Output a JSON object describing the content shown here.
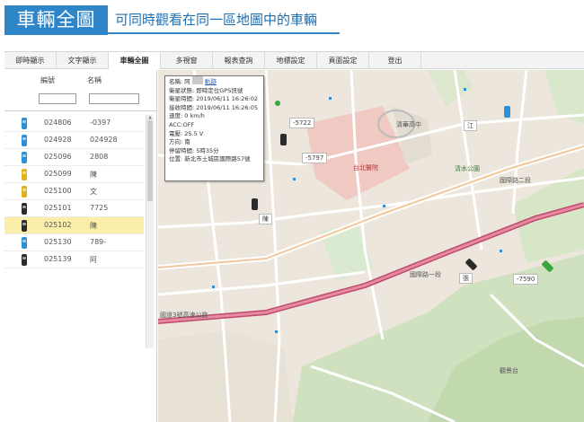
{
  "header": {
    "title": "車輛全圖",
    "subtitle": "可同時觀看在同一區地圖中的車輛"
  },
  "tabs": [
    {
      "label": "即時顯示",
      "active": false
    },
    {
      "label": "文字顯示",
      "active": false
    },
    {
      "label": "車輛全圖",
      "active": true
    },
    {
      "label": "多視窗",
      "active": false
    },
    {
      "label": "報表查詢",
      "active": false
    },
    {
      "label": "地標設定",
      "active": false
    },
    {
      "label": "頁面設定",
      "active": false
    },
    {
      "label": "登出",
      "active": false
    }
  ],
  "vehicle_panel": {
    "col_code": "編號",
    "col_name": "名稱",
    "rows": [
      {
        "code": "024806",
        "name": "-0397",
        "color": "#2d8fd6",
        "selected": false
      },
      {
        "code": "024928",
        "name": "024928",
        "color": "#2d8fd6",
        "selected": false
      },
      {
        "code": "025096",
        "name": "2808",
        "color": "#2d8fd6",
        "selected": false
      },
      {
        "code": "025099",
        "name": "陳",
        "color": "#e0b21c",
        "selected": false
      },
      {
        "code": "025100",
        "name": "文",
        "color": "#e0b21c",
        "selected": false
      },
      {
        "code": "025101",
        "name": "7725",
        "color": "#2b2b2b",
        "selected": false
      },
      {
        "code": "025102",
        "name": "陳",
        "color": "#2b2b2b",
        "selected": true
      },
      {
        "code": "025130",
        "name": "789-",
        "color": "#2d8fd6",
        "selected": false
      },
      {
        "code": "025139",
        "name": "阿",
        "color": "#2b2b2b",
        "selected": false
      }
    ]
  },
  "popup": {
    "line_name_prefix": "名稱: 阿",
    "line_name_link": "軌跡",
    "line_status": "衛星狀態: 即時定位GPS訊號",
    "line_sat_time": "衛星時間: 2019/06/11 16:26:02",
    "line_recv_time": "接收時間: 2019/06/11 16:26:05",
    "line_speed": "速度: 0 km/h",
    "line_acc": "ACC:OFF",
    "line_voltage": "電壓: 25.5 V",
    "line_direction": "方向: 南",
    "line_stop": "停留時間: 5時35分",
    "line_location": "位置: 新北市土城區國際路57號"
  },
  "map": {
    "vehicle_labels": [
      {
        "text": "-5722",
        "prefix": ""
      },
      {
        "text": "-5797",
        "prefix": ""
      },
      {
        "text": "陳",
        "prefix": ""
      },
      {
        "text": "-7590",
        "prefix": ""
      },
      {
        "text": "江",
        "prefix": ""
      },
      {
        "text": "張",
        "prefix": ""
      }
    ],
    "places": {
      "road1": "國際路一段",
      "road2": "國際路二段",
      "expressway": "國道3號高速公路",
      "school": "清華高中",
      "hospital": "台北醫院",
      "park": "清水公園",
      "spot": "觀景台"
    }
  }
}
